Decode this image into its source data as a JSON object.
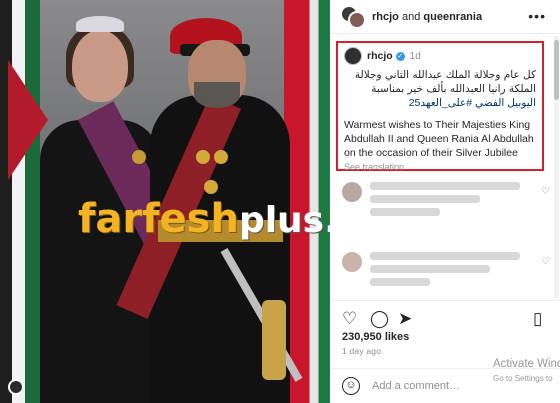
{
  "header": {
    "user1": "rhcjo",
    "joiner": "and",
    "user2": "queenrania",
    "more": "•••"
  },
  "caption": {
    "username": "rhcjo",
    "time": "1d",
    "arabic_line1": "كل عام وجلالة الملك عبدالله الثاني وجلالة",
    "arabic_line2": "الملكة رانيا العبدالله بألف خير بمناسبة",
    "arabic_line3": "اليوبيل الفضي",
    "hashtag": "#على_العهد25",
    "english": "Warmest wishes to Their Majesties King Abdullah II and Queen Rania Al Abdullah on the occasion of their Silver Jubilee",
    "see_translation": "See translation"
  },
  "watermark": {
    "part1": "farfesh",
    "part2": "plus.com"
  },
  "post": {
    "likes": "230,950 likes",
    "ago": "1 day ago"
  },
  "comment_box": {
    "placeholder": "Add a comment…"
  },
  "os_overlay": {
    "line1": "Activate Wind",
    "line2": "Go to Settings to"
  },
  "icons": [
    "heart-icon",
    "comment-icon",
    "share-icon",
    "bookmark-icon",
    "emoji-icon",
    "more-icon"
  ]
}
